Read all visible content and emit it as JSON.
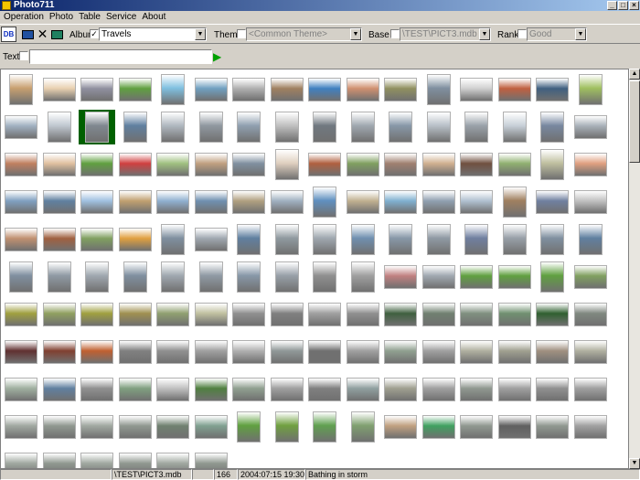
{
  "window": {
    "title": "Photo711"
  },
  "menu": [
    "Operation",
    "Photo",
    "Table",
    "Service",
    "About"
  ],
  "toolbar": {
    "db_label": "DB",
    "album": {
      "label": "Album",
      "checked": true,
      "value": "Travels"
    },
    "theme": {
      "label": "Theme",
      "checked": false,
      "placeholder": "<Common Theme>"
    },
    "base": {
      "label": "Base",
      "checked": false,
      "value": "\\TEST\\PICT3.mdb"
    },
    "rank": {
      "label": "Rank",
      "checked": false,
      "value": "Good"
    },
    "text": {
      "label": "Text",
      "checked": false,
      "value": ""
    }
  },
  "icons": {
    "db": "database-icon",
    "screen": "screen-icon",
    "delete": "delete-icon",
    "multi": "multi-screen-icon",
    "go": "go-arrow-icon"
  },
  "thumbnail_palettes": [
    [
      "#c8a070",
      "#e8d0b0",
      "#9090a0",
      "#60a040",
      "#80c0e0",
      "#70a0c0",
      "#b0b0b0",
      "#a08060",
      "#4080c0",
      "#d09070",
      "#909060",
      "#8090a0",
      "#d0d0d0",
      "#c06040",
      "#406080",
      "#a0c060",
      "#e0e0e0",
      "#606060"
    ],
    [
      "#a0b0c0",
      "#c0c8d0",
      "#808890",
      "#6080a0",
      "#b0b8c0",
      "#9098a0",
      "#90a0b0",
      "#c0c0c0",
      "#707880",
      "#a0a8b0",
      "#8898a8",
      "#b8c0c8",
      "#9aa2aa",
      "#c8d0d8",
      "#7888a0",
      "#a8b0b8",
      "#98a8b8",
      "#b0c0d0"
    ],
    [
      "#c08060",
      "#e0c0a0",
      "#60a040",
      "#d04040",
      "#a0c080",
      "#c0a080",
      "#8090a0",
      "#e0d0c0",
      "#b06040",
      "#80a060",
      "#a08070",
      "#d0b090",
      "#705040",
      "#90b070",
      "#c0c0a0",
      "#e0a080",
      "#908070",
      "#a0a090"
    ],
    [
      "#80a0c0",
      "#6080a0",
      "#a0c0e0",
      "#c0a070",
      "#90b0d0",
      "#7090b0",
      "#b0a080",
      "#a0b0c0",
      "#6090c0",
      "#c0b090",
      "#80b0d0",
      "#90a0b0",
      "#b0c0d0",
      "#a08060",
      "#7080a0",
      "#c0c0c0",
      "#8090b0",
      "#d0b080"
    ],
    [
      "#c09070",
      "#a06040",
      "#80a060",
      "#e0a040",
      "#8090a0",
      "#a0a8b0",
      "#6080a0",
      "#909aa0",
      "#a0a8b0",
      "#7090b0",
      "#8898a8",
      "#909aa4",
      "#7080a0",
      "#98a0a8",
      "#8090a0",
      "#6080a0",
      "#808890",
      "#7088a0"
    ],
    [
      "#8090a0",
      "#909aa4",
      "#a0a8b0",
      "#8090a0",
      "#a0a8b0",
      "#909aa4",
      "#8898a8",
      "#98a0a8",
      "#909090",
      "#a0a0a0",
      "#c08080",
      "#a0a8b0",
      "#60a040",
      "#60a040",
      "#60a040",
      "#80a060",
      "#a0a0a0",
      "#909090"
    ],
    [
      "#a0a040",
      "#90a060",
      "#a0a040",
      "#a09050",
      "#90a070",
      "#c0c0a0",
      "#909090",
      "#808080",
      "#a0a0a0",
      "#909090",
      "#406040",
      "#708070",
      "#809080",
      "#709070",
      "#306030",
      "#808880",
      "#408040",
      "#306030"
    ],
    [
      "#603030",
      "#804030",
      "#c06030",
      "#808080",
      "#909090",
      "#a0a0a0",
      "#b0b0b0",
      "#909898",
      "#707070",
      "#a0a0a0",
      "#90a090",
      "#a0a0a0",
      "#b0b0a0",
      "#a0a090",
      "#a09080",
      "#b0b0a0",
      "#a0a090",
      "#a09890"
    ],
    [
      "#a0b0a0",
      "#6080a0",
      "#909090",
      "#80a080",
      "#c0c0c0",
      "#508040",
      "#90a090",
      "#a0a0a0",
      "#808080",
      "#90a0a0",
      "#a0a090",
      "#a0a0a0",
      "#909890",
      "#a0a0a0",
      "#909090",
      "#a0a0a0",
      "#a0a0a0",
      "#909090"
    ],
    [
      "#a0a8a0",
      "#909890",
      "#a0a8a0",
      "#909890",
      "#708070",
      "#80a090",
      "#60a040",
      "#70a040",
      "#60a050",
      "#80a070",
      "#c0a080",
      "#40a060",
      "#909890",
      "#606060",
      "#909890",
      "#a0a0a0",
      "#b0b0b0",
      "#909890"
    ],
    [
      "#a0a8a0",
      "#909890",
      "#a0a8a0",
      "#909890",
      "#a0a8a0",
      "#909890"
    ]
  ],
  "statusbar": {
    "path": "\\TEST\\PICT3.mdb",
    "count": "166",
    "datetime": "2004:07:15 19:30:56",
    "caption": "Bathing in storm"
  }
}
